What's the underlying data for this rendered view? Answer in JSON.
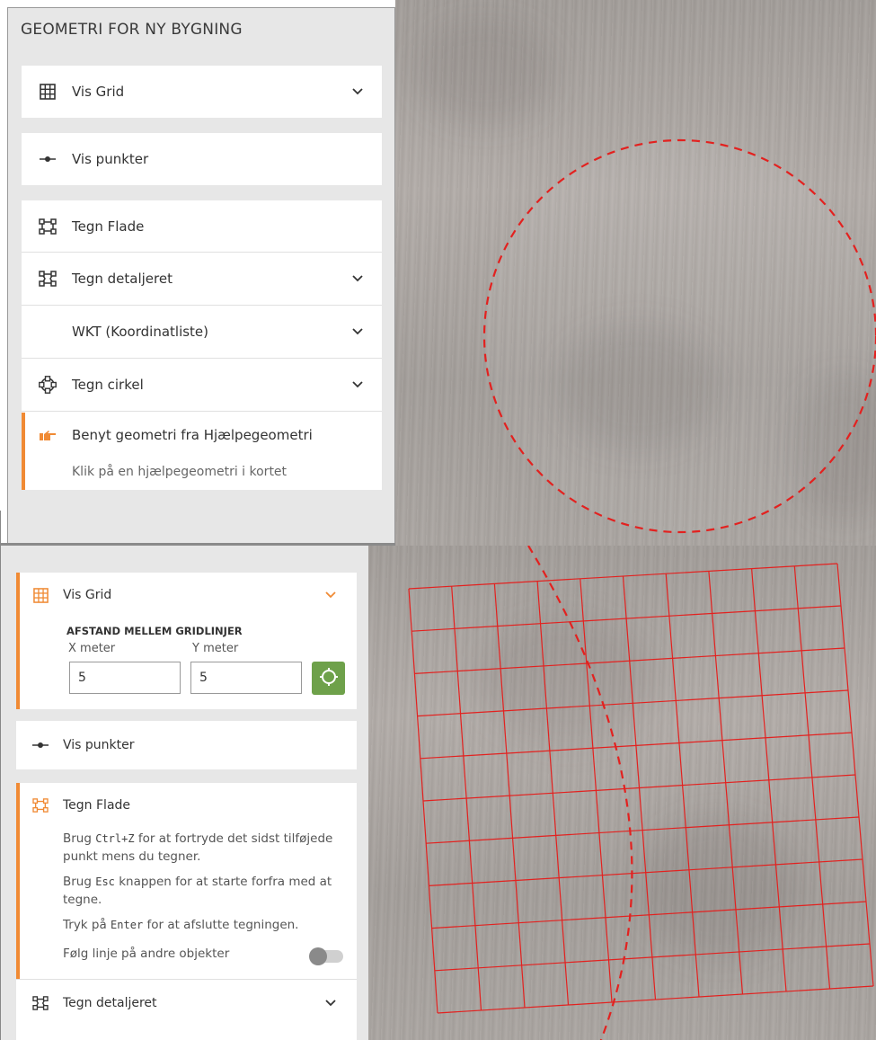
{
  "top_panel": {
    "title": "GEOMETRI FOR NY BYGNING",
    "items": [
      {
        "icon": "grid-icon",
        "label": "Vis Grid",
        "has_chevron": true
      },
      {
        "icon": "points-icon",
        "label": "Vis punkter",
        "has_chevron": false
      },
      {
        "icon": "draw-area-icon",
        "label": "Tegn Flade",
        "has_chevron": false
      },
      {
        "icon": "draw-detailed-icon",
        "label": "Tegn detaljeret",
        "has_chevron": true
      },
      {
        "icon": "",
        "label": "WKT (Koordinatliste)",
        "has_chevron": true
      },
      {
        "icon": "circle-draw-icon",
        "label": "Tegn cirkel",
        "has_chevron": true
      },
      {
        "icon": "hand-pointer-icon",
        "label": "Benyt geometri fra Hjælpegeometri",
        "has_chevron": false
      }
    ],
    "helper_hint": "Klik på en hjælpegeometri i kortet"
  },
  "bottom_panel": {
    "grid": {
      "label": "Vis Grid",
      "heading": "AFSTAND MELLEM GRIDLINJER",
      "x_label": "X meter",
      "y_label": "Y meter",
      "x_value": "5",
      "y_value": "5"
    },
    "points_label": "Vis punkter",
    "draw_area": {
      "label": "Tegn Flade",
      "hint1_a": "Brug ",
      "hint1_code": "Ctrl+Z",
      "hint1_b": " for at fortryde det sidst tilføjede",
      "hint1_line2": "punkt mens du tegner.",
      "hint2_a": "Brug ",
      "hint2_code": "Esc",
      "hint2_b": " knappen for at starte forfra med at",
      "hint2_line2": "tegne.",
      "hint3_a": "Tryk på ",
      "hint3_code": "Enter",
      "hint3_b": " for at afslutte tegningen.",
      "follow_label": "Følg linje på andre objekter",
      "follow_enabled": false
    },
    "detailed_label": "Tegn detaljeret"
  },
  "colors": {
    "accent": "#f08a34",
    "drawing": "#e3211f",
    "go_button": "#6ea14a"
  }
}
